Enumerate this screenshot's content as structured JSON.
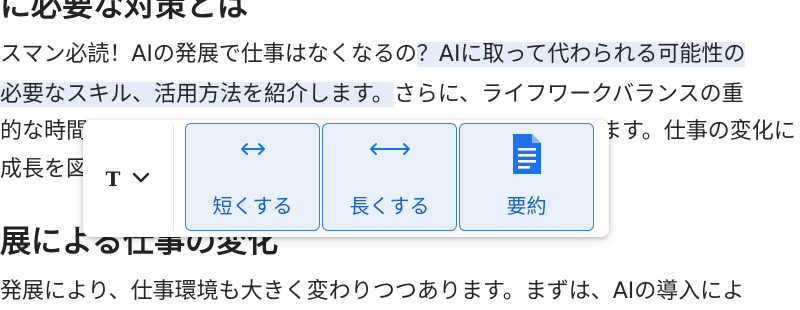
{
  "article": {
    "heading1": "に必要な対策とは",
    "p1_line1_a": "スマン必読！AIの発展で仕事はなくなるの",
    "p1_line1_b": "？AIに取って代わられる可能性の",
    "p1_line2_a": "必要なスキル、活用方法を紹介します。",
    "p1_line2_b": "さらに、ライフワークバランスの重",
    "p1_line3_a": "的な時間",
    "p1_line3_b": "ます。仕事の変化に",
    "p1_line4_a": "成長を図",
    "heading2": "展による仕事の変化",
    "p2_line1": "発展により、仕事環境も大きく変わりつつあります。まずは、AIの導入によ"
  },
  "toolbar": {
    "type_selector": {
      "glyph": "T",
      "icon": "chevron-down-icon"
    },
    "actions": [
      {
        "label": "短くする",
        "icon": "arrows-short-icon"
      },
      {
        "label": "長くする",
        "icon": "arrows-long-icon"
      },
      {
        "label": "要約",
        "icon": "document-icon"
      }
    ]
  },
  "colors": {
    "selection_highlight": "#e3ecf8",
    "button_background": "#e7f0fb",
    "button_border": "#2f80ed",
    "accent": "#1a73e8"
  }
}
